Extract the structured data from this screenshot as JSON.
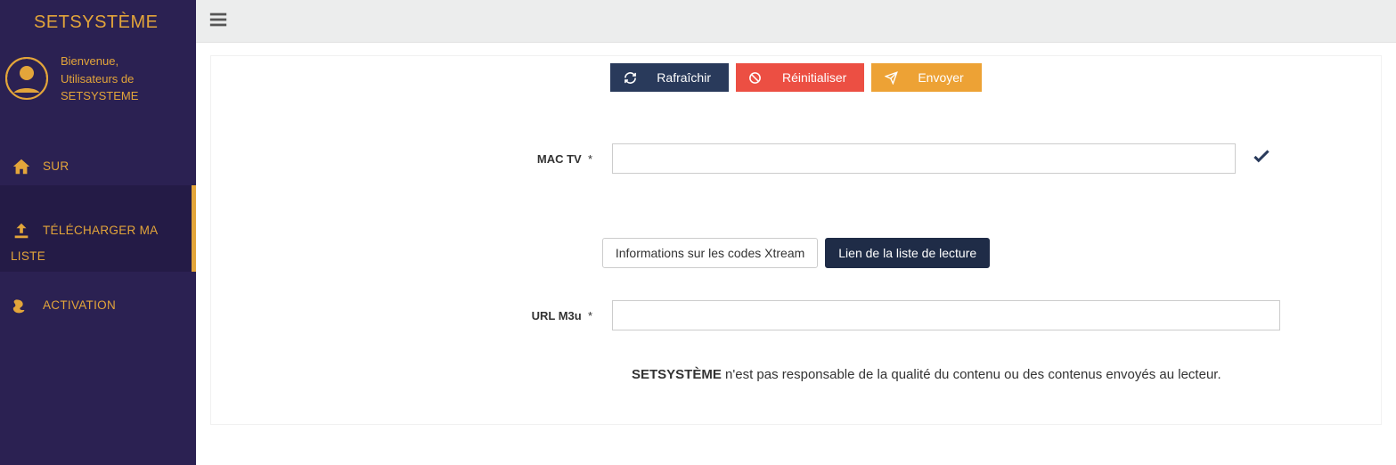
{
  "brand": "SETSYSTÈME",
  "welcome": {
    "line1": "Bienvenue,",
    "line2": "Utilisateurs de SETSYSTEME"
  },
  "nav": {
    "about": "SUR",
    "upload_line1": "TÉLÉCHARGER MA",
    "upload_line2": "LISTE",
    "activation": "ACTIVATION"
  },
  "buttons": {
    "refresh": "Rafraîchir",
    "reset": "Réinitialiser",
    "send": "Envoyer"
  },
  "form": {
    "mac_label": "MAC TV",
    "mac_value": "",
    "m3u_label": "URL M3u",
    "m3u_value": "",
    "asterisk": "*"
  },
  "tabs": {
    "xtream": "Informations sur les codes Xtream",
    "playlist": "Lien de la liste de lecture"
  },
  "disclaimer": {
    "strong": "SETSYSTÈME",
    "rest": " n'est pas responsable de la qualité du contenu ou des contenus envoyés au lecteur."
  }
}
